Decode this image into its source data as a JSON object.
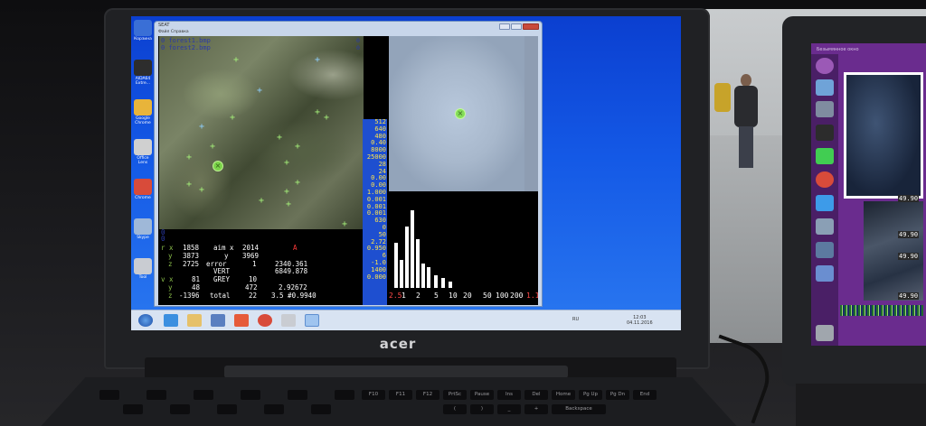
{
  "laptop": {
    "brand": "acer"
  },
  "app": {
    "title": "SEAT",
    "menu": "Файл   Справка",
    "files": [
      "0 forest1.bmp",
      "0 forest2.bmp"
    ],
    "zero_markers": [
      "0",
      "0"
    ],
    "value_column": [
      "512",
      "640",
      "480",
      "0.40",
      "8000",
      "25000",
      "28",
      "24",
      "0.00",
      "0.00",
      "1.000",
      "0.001",
      "0.001",
      "0.001",
      "630",
      "0",
      "50",
      "2.72",
      "0.950",
      "6",
      "-1.0",
      "1400",
      "0.000"
    ],
    "left_zero_markers": [
      "0",
      "0"
    ],
    "stats": {
      "row1": {
        "a": "r x",
        "b": "1858",
        "c": "aim x",
        "d": "2014",
        "e": "A"
      },
      "row2": {
        "a": "y",
        "b": "3873",
        "c": "y",
        "d": "3969"
      },
      "row3": {
        "a": "z",
        "b": "2725",
        "c": "error",
        "d": "1",
        "e": "2340.361"
      },
      "row4": {
        "a": "VERT",
        "e": "6849.878"
      },
      "row5": {
        "a": "v x",
        "b": "81",
        "c": "GREY",
        "d": "10"
      },
      "row6": {
        "a": "y",
        "b": "48",
        "d": "472",
        "e": "2.92672"
      },
      "row7": {
        "a": "z",
        "b": "-1396",
        "c": "total",
        "d": "22",
        "e": "3.5 #0.9940"
      }
    },
    "histogram": {
      "ticks": [
        "2.5",
        "1",
        "2",
        "5",
        "10",
        "20",
        "50",
        "100",
        "200",
        "1.1"
      ],
      "bars": [
        0.55,
        0.35,
        0.75,
        0.95,
        0.6,
        0.3,
        0.25,
        0.15,
        0.12,
        0.08
      ]
    }
  },
  "desktop_icons": [
    {
      "name": "Корзина",
      "color": "#3a6fd6"
    },
    {
      "name": "AIDA64 Extre...",
      "color": "#2d2d2d"
    },
    {
      "name": "Google Chrome",
      "color": "#e8b43a"
    },
    {
      "name": "Office Lens",
      "color": "#d0d0d0"
    },
    {
      "name": "Chrome",
      "color": "#d84b3a"
    },
    {
      "name": "Skype",
      "color": "#9fb8d8"
    },
    {
      "name": "Tool",
      "color": "#c9ccd2"
    }
  ],
  "taskbar": {
    "language": "RU",
    "time": "12:03",
    "date": "04.11.2016"
  },
  "right_laptop": {
    "title": "Безымянное окно",
    "numbers": [
      "49.90",
      "49.90",
      "49.90",
      "49.90"
    ]
  },
  "keyboard": {
    "function_keys": [
      "F10",
      "F11",
      "F12",
      "PrtSc",
      "Pause",
      "Ins",
      "Del",
      "Home",
      "Pg Up",
      "Pg Dn",
      "End"
    ],
    "row2": [
      "(",
      ")",
      "_",
      "+",
      "Backspace"
    ]
  }
}
